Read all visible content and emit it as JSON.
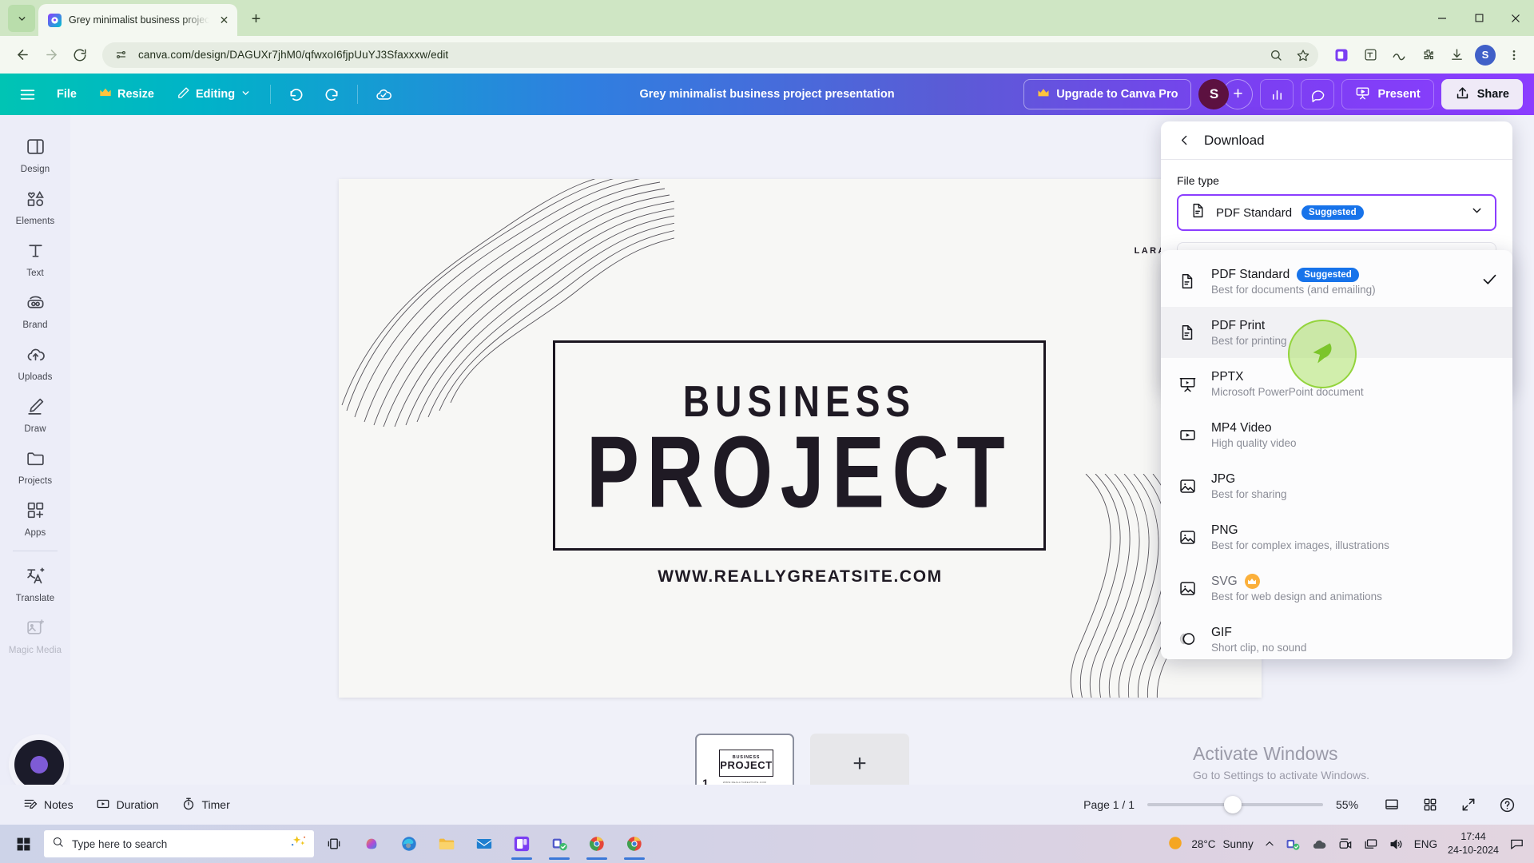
{
  "browser": {
    "tab": {
      "title": "Grey minimalist business projec",
      "favicon": "canva-icon",
      "close": "✕"
    },
    "newtab_label": "+",
    "window_controls": {
      "minimize": "—",
      "maximize": "▢",
      "close": "✕"
    },
    "url": "canva.com/design/DAGUXr7jhM0/qfwxoI6fjpUuYJ3Sfaxxxw/edit",
    "nav": {
      "back": "back-icon",
      "forward": "forward-icon",
      "reload": "reload-icon"
    },
    "profile_initial": "S"
  },
  "canva_top": {
    "menu_icon": "hamburger-icon",
    "file_label": "File",
    "resize_label": "Resize",
    "editing_label": "Editing",
    "doc_title": "Grey minimalist business project presentation",
    "upgrade_label": "Upgrade to Canva Pro",
    "avatar_initial": "S",
    "add_member_label": "+",
    "present_label": "Present",
    "share_label": "Share"
  },
  "sidebar": {
    "items": [
      {
        "label": "Design",
        "icon": "design-icon"
      },
      {
        "label": "Elements",
        "icon": "elements-icon"
      },
      {
        "label": "Text",
        "icon": "text-icon"
      },
      {
        "label": "Brand",
        "icon": "brand-icon"
      },
      {
        "label": "Uploads",
        "icon": "uploads-icon"
      },
      {
        "label": "Draw",
        "icon": "draw-icon"
      },
      {
        "label": "Projects",
        "icon": "projects-icon"
      },
      {
        "label": "Apps",
        "icon": "apps-icon"
      }
    ],
    "items_lower": [
      {
        "label": "Translate",
        "icon": "translate-icon"
      },
      {
        "label": "Magic Media",
        "icon": "magic-media-icon"
      }
    ]
  },
  "slide": {
    "title_small": "BUSINESS",
    "title_large": "PROJECT",
    "url": "WWW.REALLYGREATSITE.COM",
    "logo_text": "LARANA, INC."
  },
  "watermark": {
    "line1": "Activate Windows",
    "line2": "Go to Settings to activate Windows."
  },
  "pages": {
    "thumb_number": "1",
    "thumb_small": "BUSINESS",
    "thumb_large": "PROJECT",
    "thumb_url": "WWW.REALLYGREATSITE.COM",
    "add_label": "+"
  },
  "bottom_bar": {
    "notes_label": "Notes",
    "duration_label": "Duration",
    "timer_label": "Timer",
    "page_indicator": "Page 1 / 1",
    "zoom_level": "55%",
    "icons": [
      "fit-page-icon",
      "grid-view-icon",
      "fullscreen-icon",
      "help-icon"
    ]
  },
  "download_panel": {
    "back_icon": "chevron-left-icon",
    "title": "Download",
    "file_type_label": "File type",
    "selected": {
      "name": "PDF Standard",
      "badge": "Suggested",
      "icon": "pdf-file-icon"
    },
    "chevron": "chevron-down-icon",
    "accent_color": "#8b3dff",
    "badge_color": "#1773ea",
    "options": [
      {
        "name": "PDF Standard",
        "desc": "Best for documents (and emailing)",
        "icon": "pdf-file-icon",
        "badge": "Suggested",
        "checked": true,
        "highlighted": false,
        "pro": false
      },
      {
        "name": "PDF Print",
        "desc": "Best for printing",
        "icon": "pdf-file-icon",
        "badge": "",
        "checked": false,
        "highlighted": true,
        "pro": false
      },
      {
        "name": "PPTX",
        "desc": "Microsoft PowerPoint document",
        "icon": "pptx-icon",
        "badge": "",
        "checked": false,
        "highlighted": false,
        "pro": false
      },
      {
        "name": "MP4 Video",
        "desc": "High quality video",
        "icon": "video-icon",
        "badge": "",
        "checked": false,
        "highlighted": false,
        "pro": false
      },
      {
        "name": "JPG",
        "desc": "Best for sharing",
        "icon": "image-icon",
        "badge": "",
        "checked": false,
        "highlighted": false,
        "pro": false
      },
      {
        "name": "PNG",
        "desc": "Best for complex images, illustrations",
        "icon": "image-icon",
        "badge": "",
        "checked": false,
        "highlighted": false,
        "pro": false
      },
      {
        "name": "SVG",
        "desc": "Best for web design and animations",
        "icon": "image-icon",
        "badge": "",
        "checked": false,
        "highlighted": false,
        "pro": true
      },
      {
        "name": "GIF",
        "desc": "Short clip, no sound",
        "icon": "gif-icon",
        "badge": "",
        "checked": false,
        "highlighted": false,
        "pro": false
      }
    ]
  },
  "taskbar": {
    "search_placeholder": "Type here to search",
    "temperature": "28°C",
    "weather": "Sunny",
    "language": "ENG",
    "time": "17:44",
    "date": "24-10-2024"
  }
}
